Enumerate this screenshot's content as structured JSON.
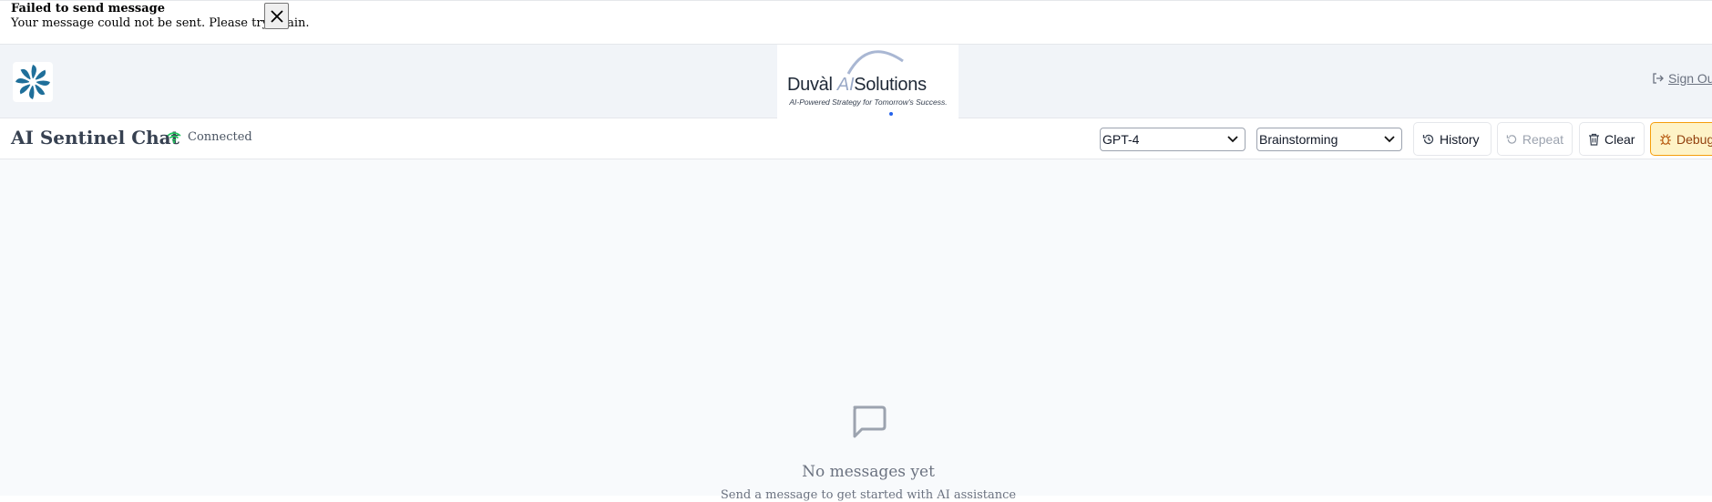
{
  "toast": {
    "title": "Failed to send message",
    "message": "Your message could not be sent. Please try again."
  },
  "header": {
    "brand_name_part1": "Duvàl",
    "brand_name_ai": "AI",
    "brand_name_part2": "Solutions",
    "brand_tagline": "AI-Powered Strategy for Tomorrow's Success.",
    "signout_label": "Sign Out"
  },
  "toolbar": {
    "title": "AI Sentinel Chat",
    "status": "Connected",
    "model_select": "GPT-4",
    "mode_select": "Brainstorming",
    "history_label": "History",
    "repeat_label": "Repeat",
    "clear_label": "Clear",
    "debug_label": "Debug"
  },
  "empty_state": {
    "title": "No messages yet",
    "subtitle": "Send a message to get started with AI assistance"
  },
  "colors": {
    "connected": "#22c55e",
    "debug_bg": "#fef3c7",
    "debug_border": "#f59e0b"
  }
}
